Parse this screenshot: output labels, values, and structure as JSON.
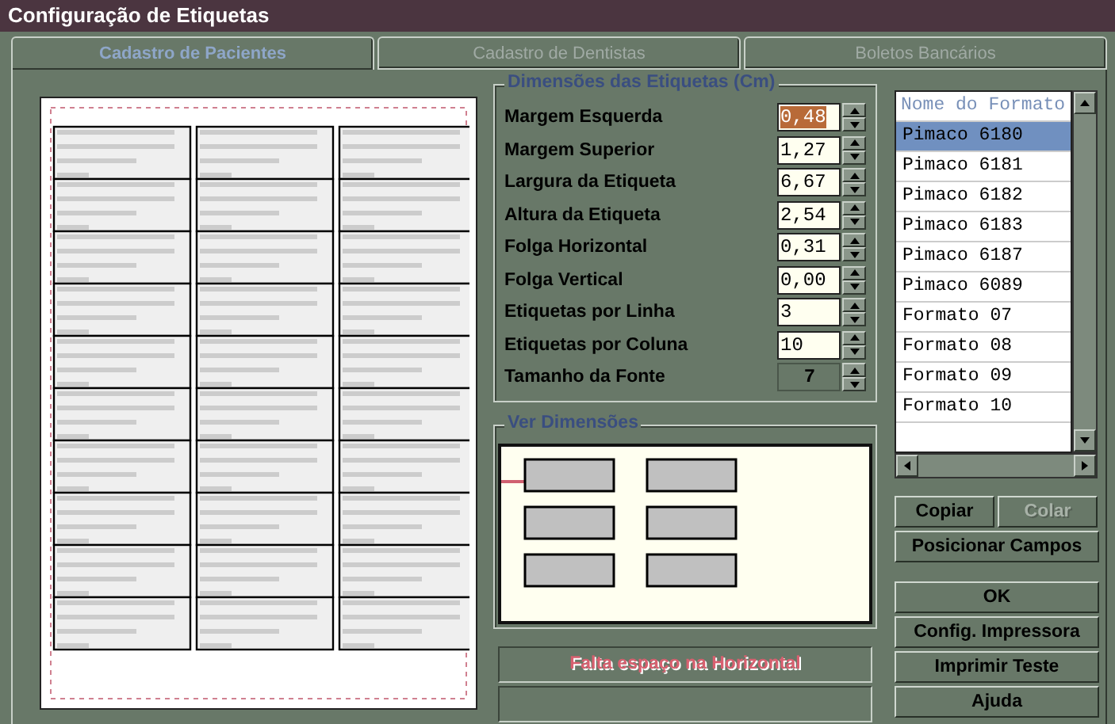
{
  "window": {
    "title": "Configuração de Etiquetas"
  },
  "tabs": [
    {
      "label": "Cadastro de Pacientes",
      "selected": true
    },
    {
      "label": "Cadastro de Dentistas",
      "selected": false
    },
    {
      "label": "Boletos Bancários",
      "selected": false
    }
  ],
  "dimensions": {
    "title": "Dimensões das Etiquetas (Cm)",
    "fields": [
      {
        "label": "Margem Esquerda",
        "value": "0,48",
        "kind": "input",
        "selected": true
      },
      {
        "label": "Margem Superior",
        "value": "1,27",
        "kind": "input",
        "selected": false
      },
      {
        "label": "Largura da Etiqueta",
        "value": "6,67",
        "kind": "input",
        "selected": false
      },
      {
        "label": "Altura da Etiqueta",
        "value": "2,54",
        "kind": "input",
        "selected": false
      },
      {
        "label": "Folga Horizontal",
        "value": "0,31",
        "kind": "input",
        "selected": false
      },
      {
        "label": "Folga Vertical",
        "value": "0,00",
        "kind": "input",
        "selected": false
      },
      {
        "label": "Etiquetas por Linha",
        "value": "3",
        "kind": "input",
        "selected": false
      },
      {
        "label": "Etiquetas por Coluna",
        "value": "10",
        "kind": "input",
        "selected": false
      },
      {
        "label": "Tamanho da Fonte",
        "value": "7",
        "kind": "readonly",
        "selected": false
      }
    ]
  },
  "preview": {
    "title": "Ver Dimensões"
  },
  "message": "Falta espaço na Horizontal",
  "formats": {
    "header": "Nome do Formato",
    "items": [
      {
        "label": "Pimaco 6180",
        "selected": true
      },
      {
        "label": "Pimaco 6181",
        "selected": false
      },
      {
        "label": "Pimaco 6182",
        "selected": false
      },
      {
        "label": "Pimaco 6183",
        "selected": false
      },
      {
        "label": "Pimaco 6187",
        "selected": false
      },
      {
        "label": "Pimaco 6089",
        "selected": false
      },
      {
        "label": "Formato 07",
        "selected": false
      },
      {
        "label": "Formato 08",
        "selected": false
      },
      {
        "label": "Formato 09",
        "selected": false
      },
      {
        "label": "Formato 10",
        "selected": false
      }
    ]
  },
  "buttons": [
    {
      "label": "Copiar",
      "disabled": false,
      "kind": "half"
    },
    {
      "label": "Colar",
      "disabled": true,
      "kind": "half"
    },
    {
      "label": "Posicionar Campos",
      "disabled": false,
      "kind": "full"
    },
    {
      "label": "OK",
      "disabled": false,
      "kind": "group-start"
    },
    {
      "label": "Config. Impressora",
      "disabled": false,
      "kind": "full"
    },
    {
      "label": "Imprimir Teste",
      "disabled": false,
      "kind": "full"
    },
    {
      "label": "Ajuda",
      "disabled": false,
      "kind": "full"
    }
  ]
}
